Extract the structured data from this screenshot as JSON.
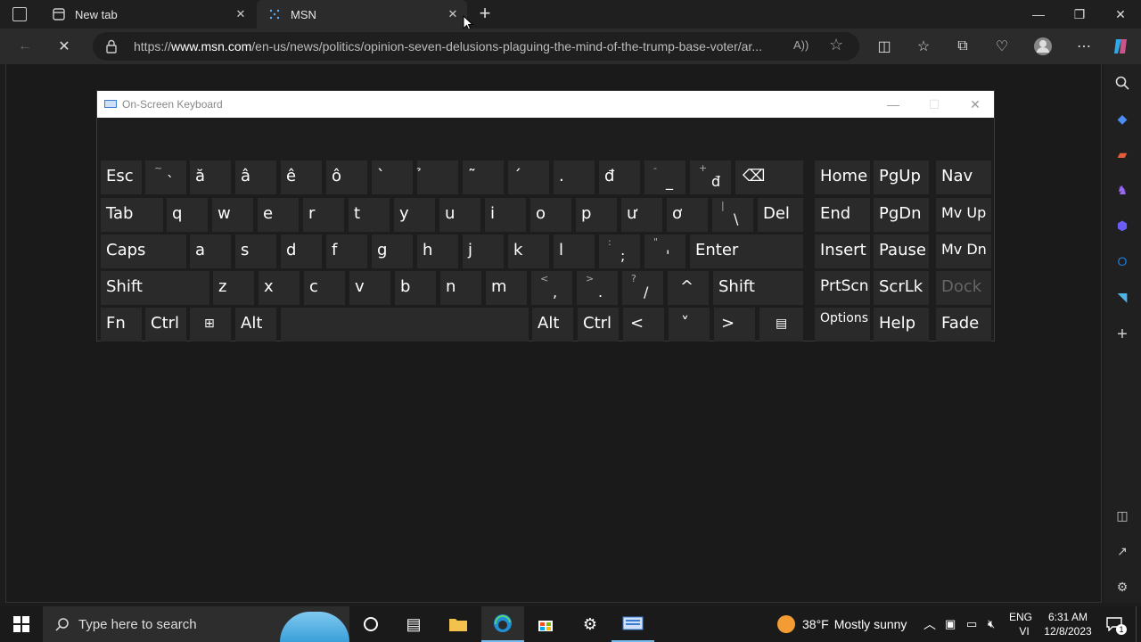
{
  "browser": {
    "tabs": [
      {
        "label": "New tab"
      },
      {
        "label": "MSN"
      }
    ],
    "address": {
      "scheme": "https://",
      "host": "www.msn.com",
      "path": "/en-us/news/politics/opinion-seven-delusions-plaguing-the-mind-of-the-trump-base-voter/ar..."
    },
    "icons": {
      "new_tab": "+",
      "close": "✕",
      "back": "←",
      "stop": "✕"
    }
  },
  "osk": {
    "title": "On-Screen Keyboard",
    "rows": [
      [
        {
          "label": "Esc"
        },
        {
          "sub": "~",
          "label": "`"
        },
        {
          "label": "ă"
        },
        {
          "label": "â"
        },
        {
          "label": "ê"
        },
        {
          "label": "ô"
        },
        {
          "label": "`"
        },
        {
          "label": "̉"
        },
        {
          "label": "˜"
        },
        {
          "label": "´"
        },
        {
          "label": "."
        },
        {
          "label": "đ"
        },
        {
          "sub": "-",
          "label": "_"
        },
        {
          "sub": "+",
          "label": "đ"
        },
        {
          "label": "⌫"
        },
        {
          "label": "Home"
        },
        {
          "label": "PgUp"
        },
        {
          "label": "Nav"
        }
      ],
      [
        {
          "label": "Tab"
        },
        {
          "label": "q"
        },
        {
          "label": "w"
        },
        {
          "label": "e"
        },
        {
          "label": "r"
        },
        {
          "label": "t"
        },
        {
          "label": "y"
        },
        {
          "label": "u"
        },
        {
          "label": "i"
        },
        {
          "label": "o"
        },
        {
          "label": "p"
        },
        {
          "label": "ư"
        },
        {
          "label": "ơ"
        },
        {
          "sub": "|",
          "label": "\\"
        },
        {
          "label": "Del"
        },
        {
          "label": "End"
        },
        {
          "label": "PgDn"
        },
        {
          "label": "Mv Up"
        }
      ],
      [
        {
          "label": "Caps"
        },
        {
          "label": "a"
        },
        {
          "label": "s"
        },
        {
          "label": "d"
        },
        {
          "label": "f"
        },
        {
          "label": "g"
        },
        {
          "label": "h"
        },
        {
          "label": "j"
        },
        {
          "label": "k"
        },
        {
          "label": "l"
        },
        {
          "sub": ":",
          "label": ";"
        },
        {
          "sub": "\"",
          "label": "'"
        },
        {
          "label": "Enter"
        },
        {
          "label": "Insert"
        },
        {
          "label": "Pause"
        },
        {
          "label": "Mv Dn"
        }
      ],
      [
        {
          "label": "Shift"
        },
        {
          "label": "z"
        },
        {
          "label": "x"
        },
        {
          "label": "c"
        },
        {
          "label": "v"
        },
        {
          "label": "b"
        },
        {
          "label": "n"
        },
        {
          "label": "m"
        },
        {
          "sub": "<",
          "label": ","
        },
        {
          "sub": ">",
          "label": "."
        },
        {
          "sub": "?",
          "label": "/"
        },
        {
          "label": "^"
        },
        {
          "label": "Shift"
        },
        {
          "label": "PrtScn"
        },
        {
          "label": "ScrLk"
        },
        {
          "label": "Dock"
        }
      ],
      [
        {
          "label": "Fn"
        },
        {
          "label": "Ctrl"
        },
        {
          "label": "⊞"
        },
        {
          "label": "Alt"
        },
        {
          "label": ""
        },
        {
          "label": "Alt"
        },
        {
          "label": "Ctrl"
        },
        {
          "label": "<"
        },
        {
          "label": "˅"
        },
        {
          "label": ">"
        },
        {
          "label": "▤"
        },
        {
          "label": "Options"
        },
        {
          "label": "Help"
        },
        {
          "label": "Fade"
        }
      ]
    ]
  },
  "taskbar": {
    "search_placeholder": "Type here to search",
    "weather": {
      "temp": "38°F",
      "text": "Mostly sunny"
    },
    "lang": {
      "top": "ENG",
      "bottom": "VI"
    },
    "clock": {
      "time": "6:31 AM",
      "date": "12/8/2023"
    },
    "notif_count": "1"
  }
}
